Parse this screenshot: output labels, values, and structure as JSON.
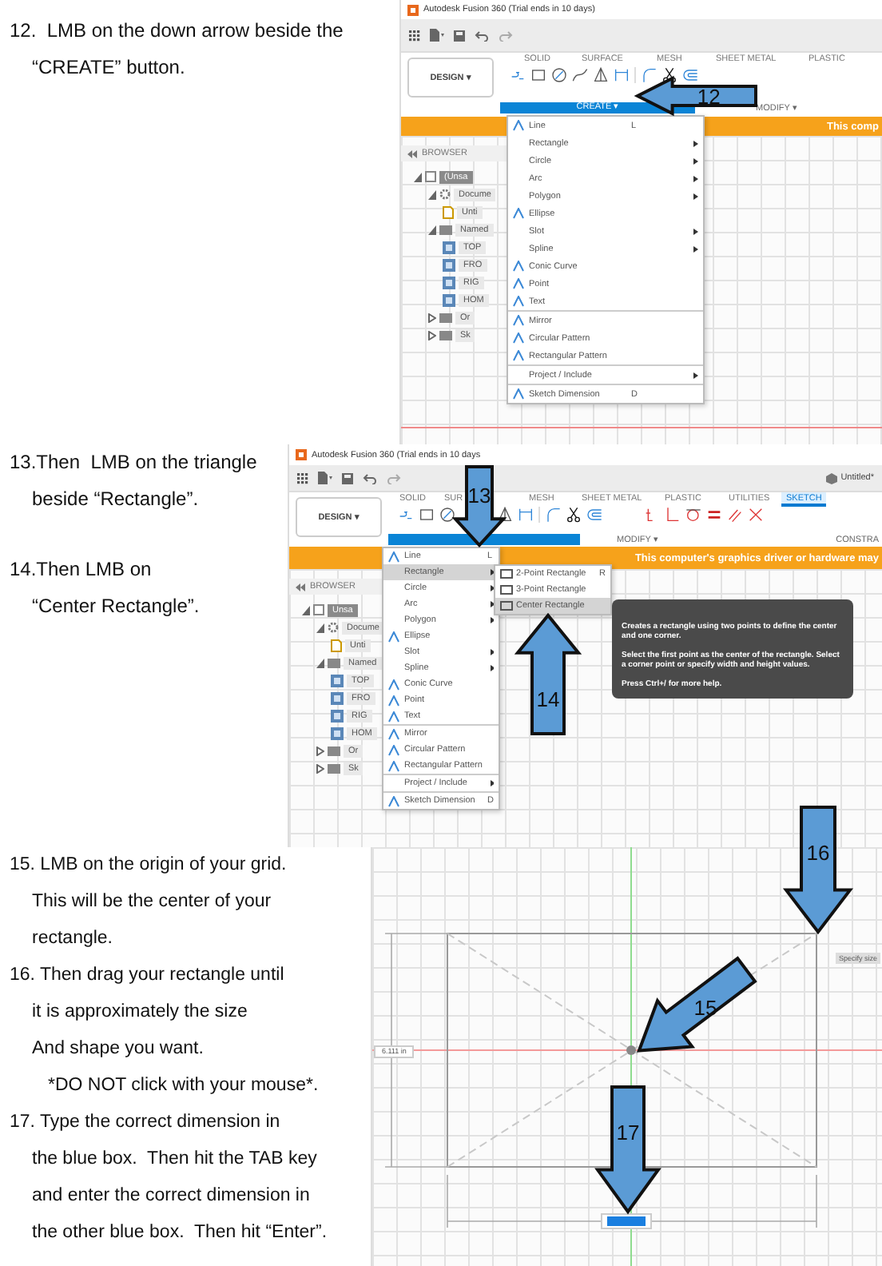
{
  "sections": [
    {
      "paragraphs": [
        {
          "kind": "step",
          "text": "12.  LMB on the down arrow beside the\n“CREATE” button."
        }
      ],
      "screen": {
        "kind": "menu",
        "title": "Autodesk Fusion 360 (Trial ends in 10 days)",
        "workspace": "DESIGN ▾",
        "tabs": [
          {
            "label": "SOLID",
            "selected": false
          },
          {
            "label": "SURFACE",
            "selected": false
          },
          {
            "label": "MESH",
            "selected": false
          },
          {
            "label": "SHEET METAL",
            "selected": false
          },
          {
            "label": "PLASTIC",
            "selected": false
          }
        ],
        "create_label": "CREATE ▾",
        "modify_label": "MODIFY ▾",
        "banner": "This comp",
        "browser_label": "BROWSER",
        "tree": [
          {
            "label": "(Unsa",
            "kind": "component",
            "expanded": true,
            "children": [
              {
                "label": "Docume",
                "kind": "settings",
                "expanded": true,
                "children": [
                  {
                    "label": "Unti",
                    "kind": "document"
                  }
                ]
              },
              {
                "label": "Named",
                "kind": "folder",
                "expanded": true,
                "children": [
                  {
                    "label": "TOP",
                    "kind": "view"
                  },
                  {
                    "label": "FRO",
                    "kind": "view"
                  },
                  {
                    "label": "RIG",
                    "kind": "view"
                  },
                  {
                    "label": "HOM",
                    "kind": "view"
                  }
                ]
              },
              {
                "label": "Or",
                "kind": "folder",
                "expanded": false
              },
              {
                "label": "Sk",
                "kind": "folder",
                "expanded": false
              }
            ]
          }
        ],
        "menu": [
          {
            "label": "Line",
            "shortcut": "L",
            "icon": true,
            "submenu": false,
            "divider_before": false,
            "selected": false
          },
          {
            "label": "Rectangle",
            "icon": false,
            "submenu": true,
            "divider_before": false,
            "selected": false
          },
          {
            "label": "Circle",
            "icon": false,
            "submenu": true,
            "divider_before": false,
            "selected": false
          },
          {
            "label": "Arc",
            "icon": false,
            "submenu": true,
            "divider_before": false,
            "selected": false
          },
          {
            "label": "Polygon",
            "icon": false,
            "submenu": true,
            "divider_before": false,
            "selected": false
          },
          {
            "label": "Ellipse",
            "icon": true,
            "submenu": false,
            "divider_before": false,
            "selected": false
          },
          {
            "label": "Slot",
            "icon": false,
            "submenu": true,
            "divider_before": false,
            "selected": false
          },
          {
            "label": "Spline",
            "icon": false,
            "submenu": true,
            "divider_before": false,
            "selected": false
          },
          {
            "label": "Conic Curve",
            "icon": true,
            "submenu": false,
            "divider_before": false,
            "selected": false
          },
          {
            "label": "Point",
            "icon": true,
            "submenu": false,
            "divider_before": false,
            "selected": false
          },
          {
            "label": "Text",
            "icon": true,
            "submenu": false,
            "divider_before": false,
            "selected": false
          },
          {
            "label": "Mirror",
            "icon": true,
            "submenu": false,
            "divider_before": true,
            "selected": false
          },
          {
            "label": "Circular Pattern",
            "icon": true,
            "submenu": false,
            "divider_before": false,
            "selected": false
          },
          {
            "label": "Rectangular Pattern",
            "icon": true,
            "submenu": false,
            "divider_before": false,
            "selected": false
          },
          {
            "label": "Project / Include",
            "icon": false,
            "submenu": true,
            "divider_before": true,
            "selected": false
          },
          {
            "label": "Sketch Dimension",
            "shortcut": "D",
            "icon": true,
            "submenu": false,
            "divider_before": true,
            "selected": false
          }
        ],
        "callouts": [
          {
            "number": "12",
            "kind": "left"
          }
        ]
      }
    },
    {
      "paragraphs": [
        {
          "kind": "step",
          "text": "13.Then  LMB on the triangle\nbeside “Rectangle”."
        },
        {
          "kind": "step",
          "text": "14.Then LMB on\n“Center Rectangle”."
        }
      ],
      "screen": {
        "kind": "menu",
        "title": "Autodesk Fusion 360 (Trial ends in 10 days",
        "document": "Untitled*",
        "workspace": "DESIGN ▾",
        "tabs": [
          {
            "label": "SOLID",
            "selected": false
          },
          {
            "label": "SUR",
            "selected": false
          },
          {
            "label": "MESH",
            "selected": false
          },
          {
            "label": "SHEET METAL",
            "selected": false
          },
          {
            "label": "PLASTIC",
            "selected": false
          },
          {
            "label": "UTILITIES",
            "selected": false
          },
          {
            "label": "SKETCH",
            "selected": true
          }
        ],
        "modify_label": "MODIFY ▾",
        "constrain_label": "CONSTRA",
        "banner": "This computer's graphics driver or hardware may",
        "browser_label": "BROWSER",
        "tree": [
          {
            "label": "Unsa",
            "kind": "component",
            "expanded": true,
            "children": [
              {
                "label": "Docume",
                "kind": "settings",
                "expanded": true,
                "children": [
                  {
                    "label": "Unti",
                    "kind": "document"
                  }
                ]
              },
              {
                "label": "Named",
                "kind": "folder",
                "expanded": true,
                "children": [
                  {
                    "label": "TOP",
                    "kind": "view"
                  },
                  {
                    "label": "FRO",
                    "kind": "view"
                  },
                  {
                    "label": "RIG",
                    "kind": "view"
                  },
                  {
                    "label": "HOM",
                    "kind": "view"
                  }
                ]
              },
              {
                "label": "Or",
                "kind": "folder",
                "expanded": false
              },
              {
                "label": "Sk",
                "kind": "folder",
                "expanded": false
              }
            ]
          }
        ],
        "menu": [
          {
            "label": "Line",
            "shortcut": "L",
            "icon": true,
            "submenu": false,
            "divider_before": false,
            "selected": false
          },
          {
            "label": "Rectangle",
            "icon": false,
            "submenu": true,
            "divider_before": false,
            "selected": true
          },
          {
            "label": "Circle",
            "icon": false,
            "submenu": true,
            "divider_before": false,
            "selected": false
          },
          {
            "label": "Arc",
            "icon": false,
            "submenu": true,
            "divider_before": false,
            "selected": false
          },
          {
            "label": "Polygon",
            "icon": false,
            "submenu": true,
            "divider_before": false,
            "selected": false
          },
          {
            "label": "Ellipse",
            "icon": true,
            "submenu": false,
            "divider_before": false,
            "selected": false
          },
          {
            "label": "Slot",
            "icon": false,
            "submenu": true,
            "divider_before": false,
            "selected": false
          },
          {
            "label": "Spline",
            "icon": false,
            "submenu": true,
            "divider_before": false,
            "selected": false
          },
          {
            "label": "Conic Curve",
            "icon": true,
            "submenu": false,
            "divider_before": false,
            "selected": false
          },
          {
            "label": "Point",
            "icon": true,
            "submenu": false,
            "divider_before": false,
            "selected": false
          },
          {
            "label": "Text",
            "icon": true,
            "submenu": false,
            "divider_before": false,
            "selected": false
          },
          {
            "label": "Mirror",
            "icon": true,
            "submenu": false,
            "divider_before": true,
            "selected": false
          },
          {
            "label": "Circular Pattern",
            "icon": true,
            "submenu": false,
            "divider_before": false,
            "selected": false
          },
          {
            "label": "Rectangular Pattern",
            "icon": true,
            "submenu": false,
            "divider_before": false,
            "selected": false
          },
          {
            "label": "Project / Include",
            "icon": false,
            "submenu": true,
            "divider_before": true,
            "selected": false
          },
          {
            "label": "Sketch Dimension",
            "shortcut": "D",
            "icon": true,
            "submenu": false,
            "divider_before": true,
            "selected": false
          }
        ],
        "submenu": [
          {
            "label": "2-Point Rectangle",
            "shortcut": "R",
            "selected": false
          },
          {
            "label": "3-Point Rectangle",
            "selected": false
          },
          {
            "label": "Center Rectangle",
            "selected": true
          }
        ],
        "tooltip": [
          "Creates a rectangle using two points to define the center and one corner.",
          "Select the first point as the center of the rectangle. Select a corner point or specify width and height values.",
          "Press Ctrl+/ for more help."
        ],
        "callouts": [
          {
            "number": "13",
            "kind": "down"
          },
          {
            "number": "14",
            "kind": "up"
          }
        ]
      }
    },
    {
      "paragraphs": [
        {
          "kind": "step",
          "text": "15. LMB on the origin of your grid.\nThis will be the center of your\nrectangle."
        },
        {
          "kind": "step",
          "text": "16. Then drag your rectangle until\nit is approximately the size\nAnd shape you want."
        },
        {
          "kind": "note",
          "text": "*DO NOT click with your mouse*."
        },
        {
          "kind": "step",
          "text": "17. Type the correct dimension in\nthe blue box.  Then hit the TAB key\nand enter the correct dimension in\nthe other blue box.  Then hit “Enter”."
        }
      ],
      "screen": {
        "kind": "canvas",
        "dimension_value": "6.111 in",
        "hint": "Specify size",
        "callouts": [
          {
            "number": "15",
            "kind": "down-left"
          },
          {
            "number": "16",
            "kind": "down"
          },
          {
            "number": "17",
            "kind": "down"
          }
        ]
      }
    }
  ]
}
